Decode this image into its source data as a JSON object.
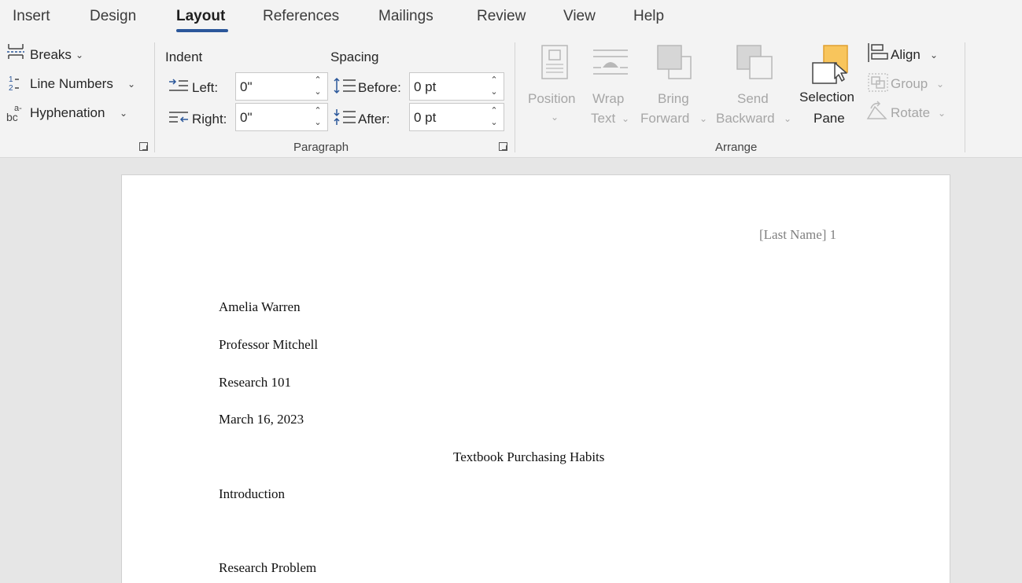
{
  "tabs": [
    "Insert",
    "Design",
    "Layout",
    "References",
    "Mailings",
    "Review",
    "View",
    "Help"
  ],
  "active_tab": "Layout",
  "page_setup": {
    "breaks": "Breaks",
    "line_numbers": "Line Numbers",
    "hyphenation": "Hyphenation"
  },
  "paragraph": {
    "indent_label": "Indent",
    "spacing_label": "Spacing",
    "left_label": "Left:",
    "right_label": "Right:",
    "before_label": "Before:",
    "after_label": "After:",
    "left_value": "0\"",
    "right_value": "0\"",
    "before_value": "0 pt",
    "after_value": "0 pt",
    "group_label": "Paragraph"
  },
  "arrange": {
    "position_l1": "Position",
    "wrap_l1": "Wrap",
    "wrap_l2": "Text",
    "bring_l1": "Bring",
    "bring_l2": "Forward",
    "send_l1": "Send",
    "send_l2": "Backward",
    "selection_l1": "Selection",
    "selection_l2": "Pane",
    "align": "Align",
    "group": "Group",
    "rotate": "Rotate",
    "group_label": "Arrange"
  },
  "document": {
    "header": "[Last Name] 1",
    "lines": [
      "Amelia Warren",
      "Professor Mitchell",
      "Research 101",
      "March 16, 2023"
    ],
    "title": "Textbook Purchasing Habits",
    "introduction": "Introduction",
    "research_problem": "Research Problem"
  },
  "colors": {
    "accent": "#2b579a",
    "selection_pane_fill": "#f8c55c"
  }
}
